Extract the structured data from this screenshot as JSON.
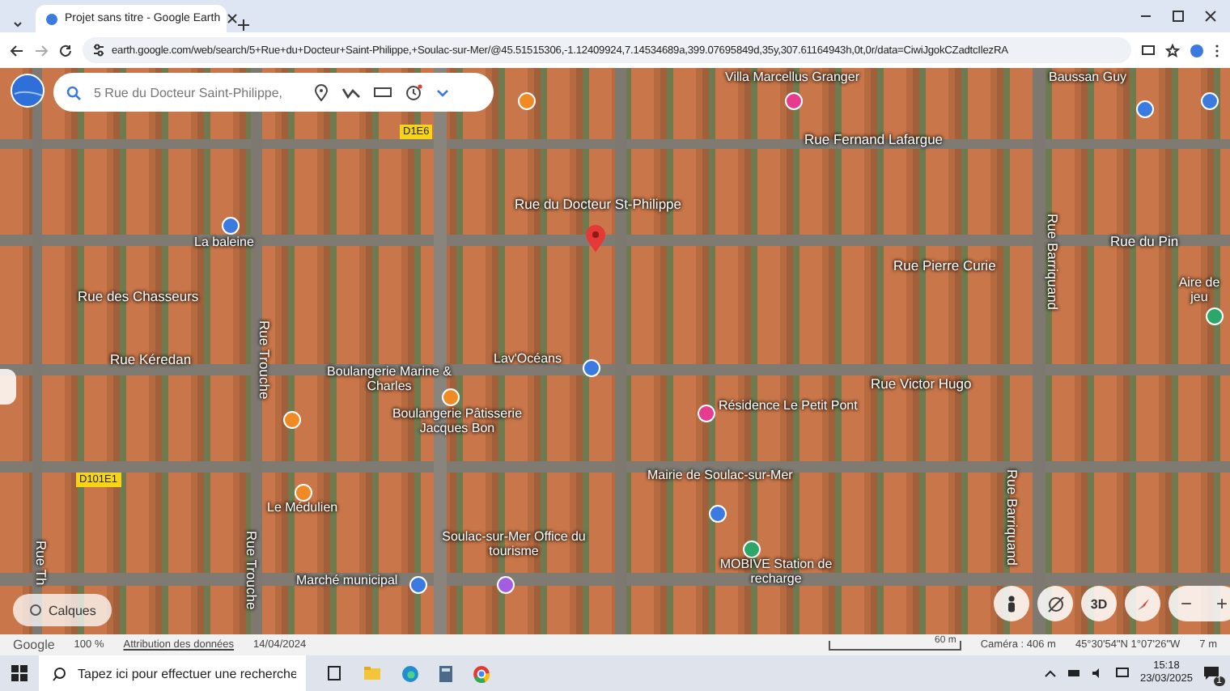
{
  "browser": {
    "tab_title": "Projet sans titre - Google Earth",
    "url": "earth.google.com/web/search/5+Rue+du+Docteur+Saint-Philippe,+Soulac-sur-Mer/@45.51515306,-1.12409924,7.14534689a,399.07695849d,35y,307.61164943h,0t,0r/data=CiwiJgokCZadtcIlezRA"
  },
  "earth": {
    "search_value": "5 Rue du Docteur Saint-Philippe,",
    "labels": [
      {
        "text": "Villa Marcellus Granger",
        "kind": "place"
      },
      {
        "text": "Baussan Guy",
        "kind": "place"
      },
      {
        "text": "Rue Fernand Lafargue",
        "kind": "street"
      },
      {
        "text": "D1E6",
        "kind": "road"
      },
      {
        "text": "Rue du Docteur St-Philippe",
        "kind": "street"
      },
      {
        "text": "La baleine",
        "kind": "place"
      },
      {
        "text": "Rue des Chasseurs",
        "kind": "street"
      },
      {
        "text": "Rue Kéredan",
        "kind": "street"
      },
      {
        "text": "Rue Trouche",
        "kind": "street"
      },
      {
        "text": "Lav'Océans",
        "kind": "place"
      },
      {
        "text": "Boulangerie Marine & Charles",
        "kind": "place"
      },
      {
        "text": "Boulangerie Pâtisserie Jacques Bon",
        "kind": "place"
      },
      {
        "text": "Rue Victor Hugo",
        "kind": "street"
      },
      {
        "text": "Résidence Le Petit Pont",
        "kind": "place"
      },
      {
        "text": "Rue Pierre Curie",
        "kind": "street"
      },
      {
        "text": "Rue du Pin",
        "kind": "street"
      },
      {
        "text": "Aire de jeu",
        "kind": "place"
      },
      {
        "text": "Rue Barriquand",
        "kind": "street"
      },
      {
        "text": "Rue Barriquand",
        "kind": "street"
      },
      {
        "text": "D101E1",
        "kind": "road"
      },
      {
        "text": "Le Médulien",
        "kind": "place"
      },
      {
        "text": "Rue Trouche",
        "kind": "street"
      },
      {
        "text": "Soulac-sur-Mer Office du tourisme",
        "kind": "place"
      },
      {
        "text": "Marché municipal",
        "kind": "place"
      },
      {
        "text": "Mairie de Soulac-sur-Mer",
        "kind": "place"
      },
      {
        "text": "MOBIVE Station de recharge",
        "kind": "place"
      },
      {
        "text": "Rue Th",
        "kind": "street"
      }
    ],
    "layers_button": "Calques",
    "view_3d_button": "3D",
    "zoom_out": "−",
    "zoom_in": "+"
  },
  "status_bar": {
    "brand": "Google",
    "zoom": "100 %",
    "attribution": "Attribution des données",
    "date": "14/04/2024",
    "scale": "60 m",
    "camera": "Caméra : 406 m",
    "coordinates": "45°30'54\"N 1°07'26\"W",
    "elevation": "7 m"
  },
  "taskbar": {
    "search_placeholder": "Tapez ici pour effectuer une recherche",
    "time": "15:18",
    "date": "23/03/2025",
    "notifications": "1"
  }
}
